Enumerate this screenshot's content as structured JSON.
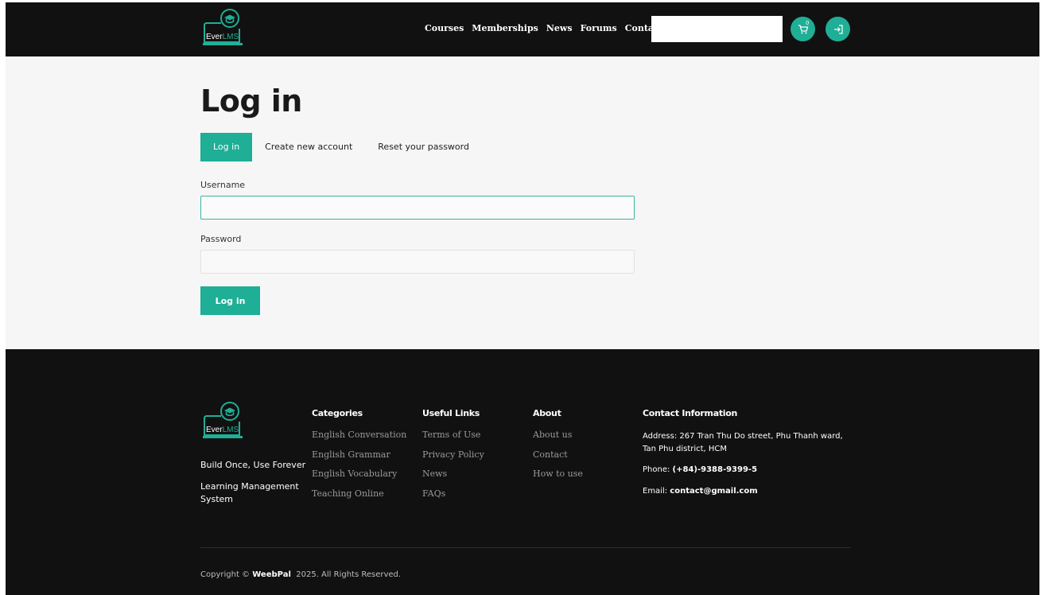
{
  "brand": {
    "logo_text_dark": "Ever",
    "logo_text_accent": "LMS",
    "accent_color": "#1fae96"
  },
  "header": {
    "nav": [
      {
        "label": "Courses"
      },
      {
        "label": "Memberships"
      },
      {
        "label": "News"
      },
      {
        "label": "Forums"
      },
      {
        "label": "Contact Us"
      }
    ],
    "search": {
      "placeholder": "",
      "value": "",
      "icon": "search-icon"
    },
    "cart_badge": "0",
    "cart_icon": "cart-icon",
    "login_icon": "login-icon"
  },
  "main": {
    "title": "Log in",
    "tabs": [
      {
        "label": "Log in",
        "active": true
      },
      {
        "label": "Create new account",
        "active": false
      },
      {
        "label": "Reset your password",
        "active": false
      }
    ],
    "username_label": "Username",
    "username_value": "",
    "password_label": "Password",
    "password_value": "",
    "submit_label": "Log in"
  },
  "footer": {
    "tagline_1": "Build Once, Use Forever",
    "tagline_2": "Learning Management System",
    "columns": [
      {
        "title": "Categories",
        "items": [
          "English Conversation",
          "English Grammar",
          "English Vocabulary",
          "Teaching Online"
        ]
      },
      {
        "title": "Useful Links",
        "items": [
          "Terms of Use",
          "Privacy Policy",
          "News",
          "FAQs"
        ]
      },
      {
        "title": "About",
        "items": [
          "About us",
          "Contact",
          "How to use"
        ]
      }
    ],
    "contact": {
      "title": "Contact Information",
      "address": "Address: 267 Tran Thu Do street, Phu Thanh ward, Tan Phu district, HCM",
      "phone_label": "Phone: ",
      "phone": "(+84)-9388-9399-5",
      "email_label": "Email: ",
      "email": "contact@gmail.com"
    },
    "copyright_prefix": "Copyright © ",
    "copyright_brand": "WeebPal",
    "copyright_suffix": "  2025. All Rights Reserved."
  }
}
